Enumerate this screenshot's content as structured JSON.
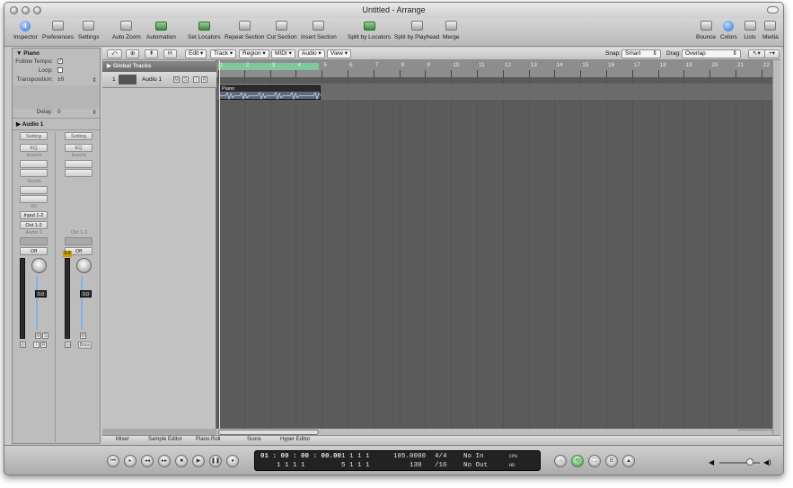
{
  "window": {
    "title": "Untitled - Arrange"
  },
  "toolbar": {
    "inspector": "Inspector",
    "preferences": "Preferences",
    "settings": "Settings",
    "auto_zoom": "Auto Zoom",
    "automation": "Automation",
    "set_locators": "Set Locators",
    "repeat_section": "Repeat Section",
    "cut_section": "Cut Section",
    "insert_section": "Insert Section",
    "split_by_locators": "Split by Locators",
    "split_by_playhead": "Split by Playhead",
    "merge": "Merge",
    "bounce": "Bounce",
    "colors": "Colors",
    "lists": "Lists",
    "media": "Media"
  },
  "inspector": {
    "region_name": "Piano",
    "follow_tempo": "Follow Tempo:",
    "loop": "Loop:",
    "transposition": "Transposition:",
    "transposition_value": "±0",
    "delay": "Delay:",
    "delay_value": "0",
    "track_name": "Audio 1",
    "strip1": {
      "setting": "Setting",
      "eq": "EQ",
      "inserts": "Inserts",
      "sends": "Sends",
      "io": "I/O",
      "input": "Input 1-2",
      "output": "Out 1-2",
      "name": "Audio 1",
      "off": "Off",
      "fader": "0.0"
    },
    "strip2": {
      "setting": "Setting",
      "eq": "EQ",
      "inserts": "Inserts",
      "name": "Out 1-2",
      "off": "Off",
      "fader": "0.0",
      "peak": "0.0",
      "bnce": "Bnce"
    }
  },
  "local": {
    "edit": "Edit",
    "track": "Track",
    "region": "Region",
    "midi": "MIDI",
    "audio": "Audio",
    "view": "View",
    "snap_label": "Snap:",
    "snap_value": "Smart",
    "drag_label": "Drag:",
    "drag_value": "Overlap"
  },
  "global_tracks": "Global Tracks",
  "track": {
    "number": "1",
    "name": "Audio 1"
  },
  "region": {
    "name": "Piano"
  },
  "ruler": [
    "1",
    "2",
    "3",
    "4",
    "5",
    "6",
    "7",
    "8",
    "9",
    "10",
    "11",
    "12",
    "13",
    "14",
    "15",
    "16",
    "17",
    "18",
    "19",
    "20",
    "21",
    "22"
  ],
  "bottom_tabs": [
    "Mixer",
    "Sample Editor",
    "Piano Roll",
    "Score",
    "Hyper Editor"
  ],
  "lcd": {
    "smpte": "01 : 00 : 00 : 00.00",
    "bars": "1   1   1     1",
    "loc1": "1   1   1     1",
    "loc2": "5   1   1     1",
    "tempo": "105.0000",
    "tempo2": "130",
    "sig": "4/4",
    "div": "/16",
    "in": "No In",
    "out": "No Out",
    "cpu": "CPU",
    "hd": "HD"
  }
}
